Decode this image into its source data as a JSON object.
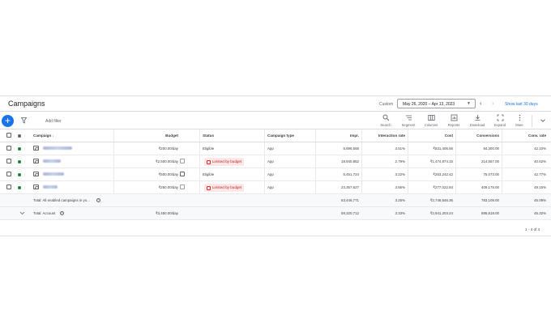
{
  "header": {
    "title": "Campaigns",
    "custom_label": "Custom",
    "date_range": "May 26, 2020 – Apr 13, 2023",
    "show_last": "Show last 30 days"
  },
  "toolbar": {
    "add_filter": "Add filter",
    "tools": [
      {
        "label": "Search",
        "icon": "search-icon"
      },
      {
        "label": "Segment",
        "icon": "segment-icon"
      },
      {
        "label": "Columns",
        "icon": "columns-icon"
      },
      {
        "label": "Reports",
        "icon": "reports-icon"
      },
      {
        "label": "Download",
        "icon": "download-icon"
      },
      {
        "label": "Expand",
        "icon": "expand-icon"
      },
      {
        "label": "More",
        "icon": "more-vert-icon"
      }
    ]
  },
  "table": {
    "columns": {
      "campaign": "Campaign",
      "budget": "Budget",
      "status": "Status",
      "campaign_type": "Campaign type",
      "impr": "Impr.",
      "interaction_rate": "Interaction rate",
      "cost": "Cost",
      "conversions": "Conversions",
      "conv_rate": "Conv. rate"
    },
    "rows": [
      {
        "budget": "₹200.00/day",
        "status": "Eligible",
        "limited": false,
        "type": "App",
        "impr": "5,696,568",
        "interaction_rate": "3.51%",
        "cost": "₹831,406.56",
        "conversions": "84,300.00",
        "conv_rate": "42.10%"
      },
      {
        "budget": "₹2,500.00/day",
        "status": "Limited by budget",
        "limited": true,
        "type": "App",
        "impr": "18,940,852",
        "interaction_rate": "2.79%",
        "cost": "₹1,474,874.15",
        "conversions": "214,557.00",
        "conv_rate": "40.62%"
      },
      {
        "budget": "₹500.00/day",
        "status": "Eligible",
        "limited": false,
        "type": "App",
        "impr": "5,451,724",
        "interaction_rate": "3.22%",
        "cost": "₹263,242.42",
        "conversions": "75,073.00",
        "conv_rate": "42.77%"
      },
      {
        "budget": "₹250.00/day",
        "status": "Limited by budget",
        "limited": true,
        "type": "App",
        "impr": "23,357,627",
        "interaction_rate": "3.56%",
        "cost": "₹277,022.84",
        "conversions": "409,175.00",
        "conv_rate": "49.15%"
      }
    ],
    "total_enabled": {
      "label": "Total: All enabled campaigns in yo...",
      "impr": "53,446,771",
      "interaction_rate": "3.25%",
      "cost": "₹2,746,546.36",
      "conversions": "783,105.00",
      "conv_rate": "45.09%"
    },
    "total_account": {
      "label": "Total: Account",
      "budget": "₹3,450.00/day",
      "impr": "59,320,712",
      "interaction_rate": "3.33%",
      "cost": "₹2,941,203.24",
      "conversions": "895,818.00",
      "conv_rate": "45.32%"
    },
    "pagination": "1 - 4 of 4"
  },
  "colors": {
    "primary": "#1a73e8",
    "enabled_dot": "#188038",
    "limited_bg": "#fce8e6",
    "limited_text": "#c5221f"
  }
}
